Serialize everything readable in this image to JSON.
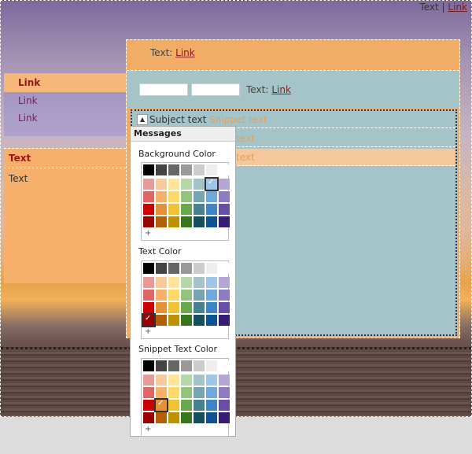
{
  "header": {
    "text": "Text",
    "separator": "|",
    "link": "Link"
  },
  "sidebar1": {
    "heading": "Link",
    "links": [
      "Link",
      "Link"
    ]
  },
  "sidebar2": {
    "heading": "Text",
    "text": "Text"
  },
  "main": {
    "bar1": {
      "label": "Text:",
      "link": "Link"
    },
    "bar2": {
      "input1": "",
      "input2": "",
      "label": "Text:",
      "link": "Link"
    },
    "rows": [
      {
        "subject": "Subject text",
        "snippet": "Snippet text"
      },
      {
        "subject": "",
        "snippet": "text"
      },
      {
        "subject": "",
        "snippet": "text"
      }
    ]
  },
  "popup": {
    "title": "Messages",
    "sections": [
      {
        "label": "Background Color",
        "selected": "#9fc5e8"
      },
      {
        "label": "Text Color",
        "selected": "#990000"
      },
      {
        "label": "Snippet Text Color",
        "selected": "#e69138"
      }
    ],
    "plus": "+",
    "gray_row": [
      "#000000",
      "#444444",
      "#666666",
      "#999999",
      "#cccccc",
      "#eeeeee",
      "#ffffff"
    ],
    "color_rows": [
      [
        "#ea9999",
        "#f9cb9c",
        "#ffe599",
        "#b6d7a8",
        "#a2c4c9",
        "#9fc5e8",
        "#b4a7d6"
      ],
      [
        "#e06666",
        "#f6b26b",
        "#ffd966",
        "#93c47d",
        "#76a5af",
        "#6fa8dc",
        "#8e7cc3"
      ],
      [
        "#cc0000",
        "#e69138",
        "#f1c232",
        "#6aa84f",
        "#45818e",
        "#3d85c6",
        "#674ea7"
      ],
      [
        "#990000",
        "#b45f06",
        "#bf9000",
        "#38761d",
        "#134f5c",
        "#0b5394",
        "#351c75"
      ]
    ]
  }
}
